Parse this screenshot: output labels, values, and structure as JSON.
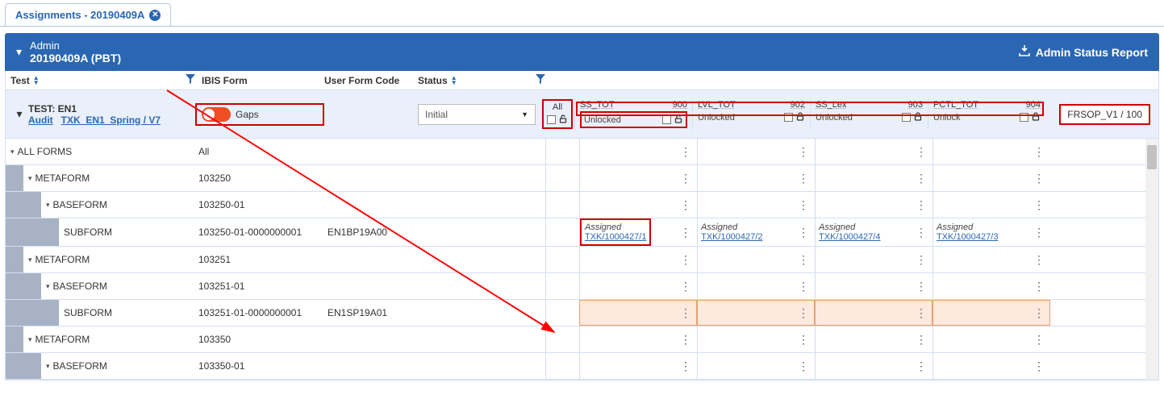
{
  "tab": {
    "title": "Assignments - 20190409A"
  },
  "banner": {
    "crumb": "Admin",
    "title": "20190409A (PBT)",
    "report_label": "Admin Status Report"
  },
  "headers": {
    "test": "Test",
    "ibis": "IBIS Form",
    "ufc": "User Form Code",
    "status": "Status"
  },
  "testrow": {
    "label": "TEST: EN1",
    "audit": "Audit",
    "link2": "TXK_EN1_Spring / V7",
    "gaps": "Gaps",
    "status_sel": "Initial",
    "all": "All"
  },
  "scores": [
    {
      "name": "SS_TOT",
      "num": "900",
      "lock": "Unlocked"
    },
    {
      "name": "LVL_TOT",
      "num": "902",
      "lock": "Unlocked"
    },
    {
      "name": "SS_Lex",
      "num": "903",
      "lock": "Unlocked"
    },
    {
      "name": "PCTL_TOT",
      "num": "904",
      "lock": "Unlock"
    }
  ],
  "overlay": "FRSOP_V1 / 100",
  "rows": [
    {
      "level": 0,
      "exp": true,
      "label": "ALL FORMS",
      "ibis": "All"
    },
    {
      "level": 1,
      "exp": true,
      "label": "METAFORM",
      "ibis": "103250"
    },
    {
      "level": 2,
      "exp": true,
      "label": "BASEFORM",
      "ibis": "103250-01"
    },
    {
      "level": 3,
      "exp": false,
      "label": "SUBFORM",
      "ibis": "103250-01-0000000001",
      "ufc": "EN1BP19A00",
      "assign": [
        "TXK/1000427/1",
        "TXK/1000427/2",
        "TXK/1000427/4",
        "TXK/1000427/3"
      ],
      "assign_prefix": "Assigned"
    },
    {
      "level": 1,
      "exp": true,
      "label": "METAFORM",
      "ibis": "103251"
    },
    {
      "level": 2,
      "exp": true,
      "label": "BASEFORM",
      "ibis": "103251-01"
    },
    {
      "level": 3,
      "exp": false,
      "label": "SUBFORM",
      "ibis": "103251-01-0000000001",
      "ufc": "EN1SP19A01",
      "highlight": true
    },
    {
      "level": 1,
      "exp": true,
      "label": "METAFORM",
      "ibis": "103350"
    },
    {
      "level": 2,
      "exp": true,
      "label": "BASEFORM",
      "ibis": "103350-01"
    }
  ]
}
